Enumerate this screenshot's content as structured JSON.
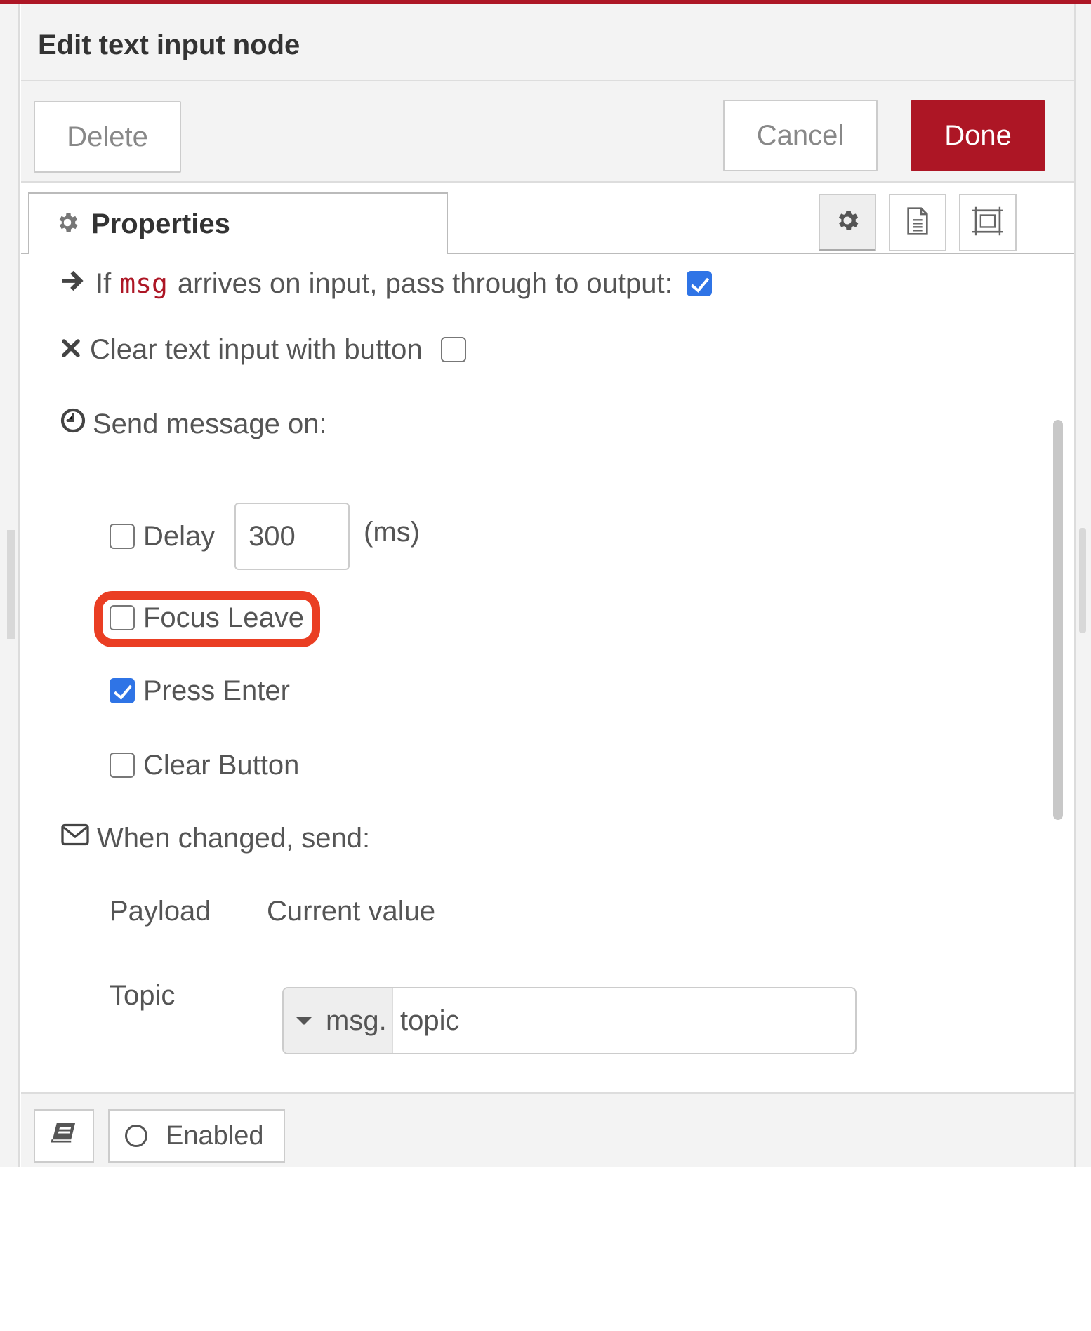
{
  "dialog": {
    "title": "Edit text input node",
    "buttons": {
      "delete": "Delete",
      "cancel": "Cancel",
      "done": "Done"
    },
    "accent_color": "#ad1625"
  },
  "tabs": {
    "properties_label": "Properties",
    "icons": [
      "gear-icon",
      "document-icon",
      "frame-icon"
    ]
  },
  "form": {
    "pass_through": {
      "prefix": "If",
      "code": "msg",
      "suffix": "arrives on input, pass through to output:",
      "checked": true
    },
    "clear_with_button": {
      "label": "Clear text input with button",
      "checked": false
    },
    "send_message_on": {
      "label": "Send message on:"
    },
    "delay": {
      "label": "Delay",
      "value": "300",
      "unit": "(ms)",
      "checked": false
    },
    "focus_leave": {
      "label": "Focus Leave",
      "checked": false
    },
    "press_enter": {
      "label": "Press Enter",
      "checked": true
    },
    "clear_button": {
      "label": "Clear Button",
      "checked": false
    },
    "when_changed": {
      "label": "When changed, send:"
    },
    "payload": {
      "label": "Payload",
      "value": "Current value"
    },
    "topic": {
      "label": "Topic",
      "type": "msg.",
      "value": "topic"
    }
  },
  "footer": {
    "enabled_label": "Enabled"
  },
  "colors": {
    "checkbox_checked": "#2f74e6",
    "highlight": "#ea3e23"
  }
}
